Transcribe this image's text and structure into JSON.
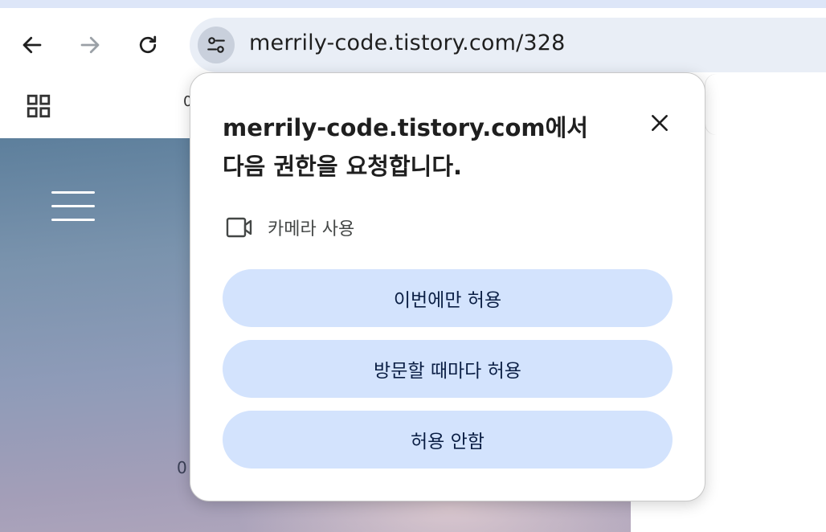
{
  "browser": {
    "url": "merrily-code.tistory.com/328",
    "bookmarks_peek": "0",
    "bookmarks_more": "⋮"
  },
  "page": {
    "hero_peek": "0"
  },
  "permission_prompt": {
    "origin": "merrily-code.tistory.com",
    "title_rest_line1": "에서",
    "title_rest_line2": "다음 권한을 요청합니다.",
    "permission": "카메라 사용",
    "buttons": {
      "allow_once": "이번에만 허용",
      "allow_always": "방문할 때마다 허용",
      "deny": "허용 안함"
    }
  },
  "colors": {
    "button_bg": "#d3e3fd",
    "omnibox_bg": "#e9eef6",
    "top_strip": "#dde6f8"
  }
}
